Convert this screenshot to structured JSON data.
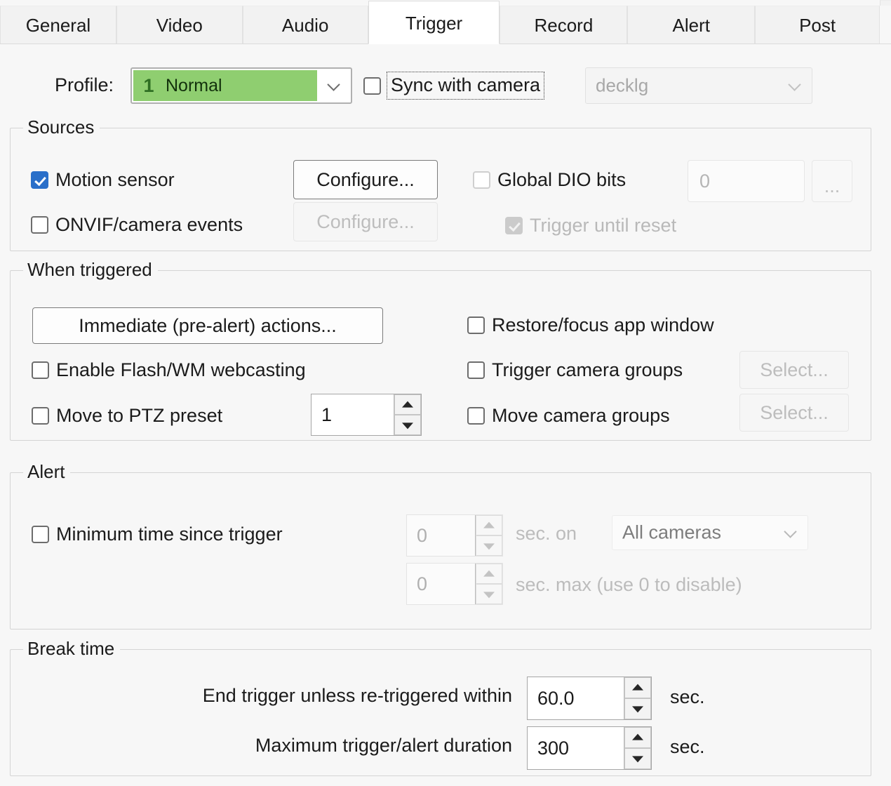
{
  "tabs": [
    {
      "label": "General",
      "active": false
    },
    {
      "label": "Video",
      "active": false
    },
    {
      "label": "Audio",
      "active": false
    },
    {
      "label": "Trigger",
      "active": true
    },
    {
      "label": "Record",
      "active": false
    },
    {
      "label": "Alert",
      "active": false
    },
    {
      "label": "Post",
      "active": false
    }
  ],
  "profile_row": {
    "label": "Profile:",
    "profile_number": "1",
    "profile_name": "Normal",
    "sync_with_camera_label": "Sync with camera",
    "sync_with_camera_checked": false,
    "camera_combo_value": "decklg",
    "camera_combo_enabled": false
  },
  "sources": {
    "title": "Sources",
    "motion_sensor_label": "Motion sensor",
    "motion_sensor_checked": true,
    "motion_configure_label": "Configure...",
    "onvif_label": "ONVIF/camera events",
    "onvif_checked": false,
    "onvif_configure_label": "Configure...",
    "global_dio_label": "Global DIO bits",
    "global_dio_checked": false,
    "global_dio_value": "0",
    "global_dio_browse_label": "...",
    "trigger_until_reset_label": "Trigger until reset",
    "trigger_until_reset_checked": true,
    "trigger_until_reset_enabled": false
  },
  "when_triggered": {
    "title": "When triggered",
    "immediate_actions_label": "Immediate (pre-alert) actions...",
    "flash_wm_label": "Enable Flash/WM webcasting",
    "flash_wm_checked": false,
    "ptz_preset_label": "Move to PTZ preset",
    "ptz_preset_checked": false,
    "ptz_preset_value": "1",
    "restore_focus_label": "Restore/focus app window",
    "restore_focus_checked": false,
    "trigger_groups_label": "Trigger camera groups",
    "trigger_groups_checked": false,
    "trigger_groups_select_label": "Select...",
    "move_groups_label": "Move camera groups",
    "move_groups_checked": false,
    "move_groups_select_label": "Select..."
  },
  "alert": {
    "title": "Alert",
    "min_time_label": "Minimum time since trigger",
    "min_time_checked": false,
    "sec_on_value": "0",
    "sec_on_label": "sec. on",
    "camera_scope_value": "All cameras",
    "sec_max_value": "0",
    "sec_max_label": "sec. max (use 0 to disable)"
  },
  "break_time": {
    "title": "Break time",
    "end_trigger_label": "End trigger unless re-triggered within",
    "end_trigger_value": "60.0",
    "end_trigger_unit": "sec.",
    "max_duration_label": "Maximum trigger/alert duration",
    "max_duration_value": "300",
    "max_duration_unit": "sec."
  },
  "colors": {
    "page_background": "#f7f7f7",
    "active_tab_background": "#ffffff",
    "profile_highlight": "#8fce70",
    "checkbox_checked": "#2a6fc9",
    "disabled_text": "#bcbcbc",
    "group_border": "#d4d4d4"
  }
}
